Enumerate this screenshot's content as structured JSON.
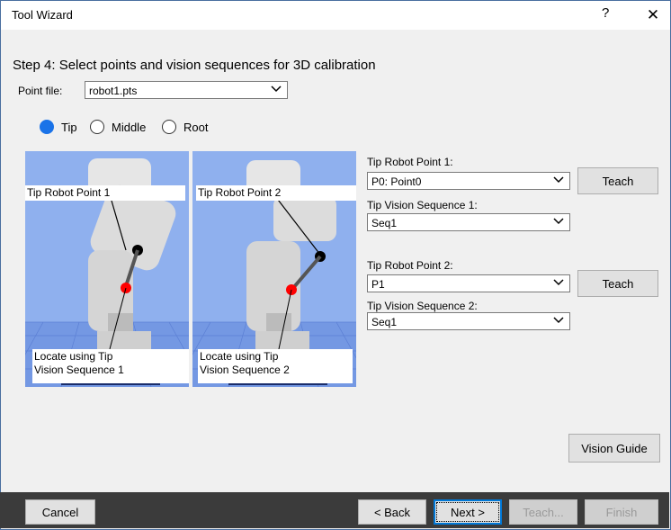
{
  "window": {
    "title": "Tool Wizard",
    "help": "?",
    "close": "✕"
  },
  "step_title": "Step 4: Select points and vision sequences for 3D calibration",
  "point_file": {
    "label": "Point file:",
    "value": "robot1.pts"
  },
  "radios": [
    {
      "label": "Tip",
      "selected": true
    },
    {
      "label": "Middle",
      "selected": false
    },
    {
      "label": "Root",
      "selected": false
    }
  ],
  "images": [
    {
      "top_label": "Tip Robot Point 1",
      "bottom_label_1": "Locate using Tip",
      "bottom_label_2": "Vision Sequence 1"
    },
    {
      "top_label": "Tip Robot Point 2",
      "bottom_label_1": "Locate using Tip",
      "bottom_label_2": "Vision Sequence 2"
    }
  ],
  "point1": {
    "label": "Tip Robot Point 1:",
    "value": "P0: Point0",
    "teach": "Teach",
    "seq_label": "Tip Vision Sequence 1:",
    "seq_value": "Seq1"
  },
  "point2": {
    "label": "Tip Robot Point 2:",
    "value": "P1",
    "teach": "Teach",
    "seq_label": "Tip Vision Sequence 2:",
    "seq_value": "Seq1"
  },
  "vision_guide": "Vision Guide",
  "footer": {
    "cancel": "Cancel",
    "back": "< Back",
    "next": "Next >",
    "teach": "Teach...",
    "finish": "Finish"
  }
}
